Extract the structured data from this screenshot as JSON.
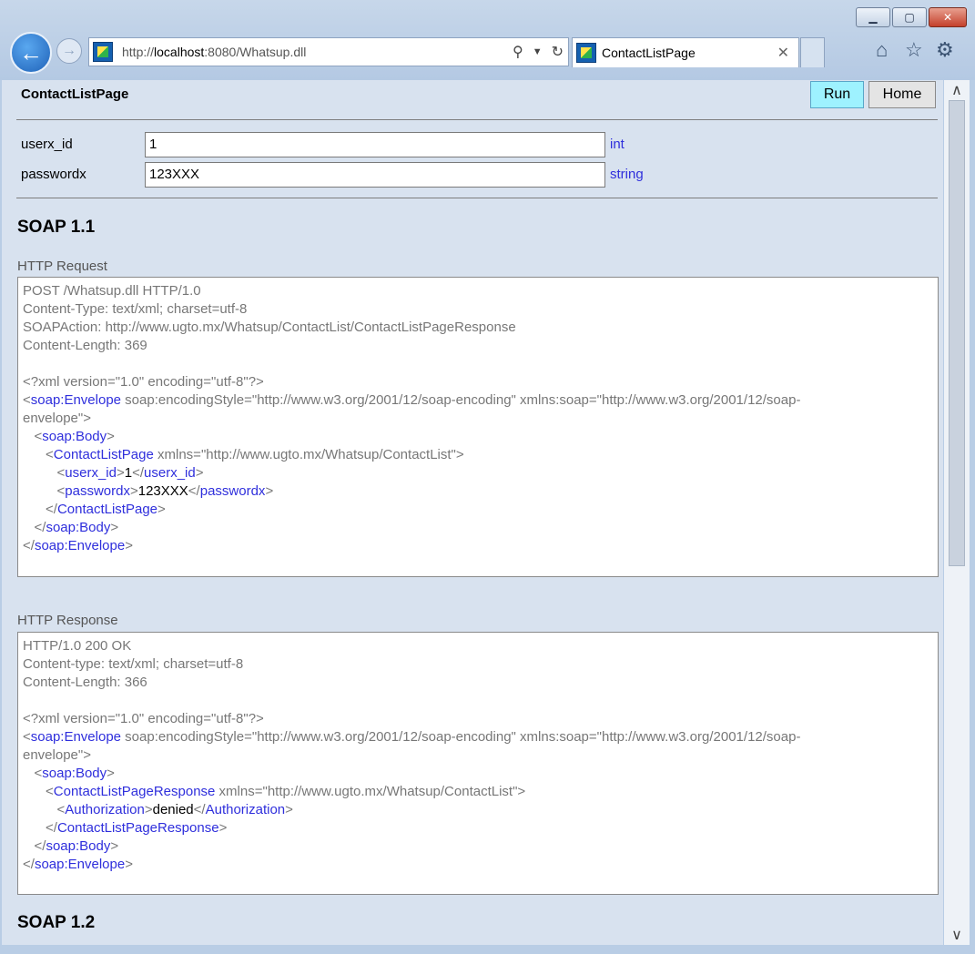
{
  "browser": {
    "url_prefix": "http://",
    "url_host": "localhost",
    "url_rest": ":8080/Whatsup.dll",
    "tab_title": "ContactListPage"
  },
  "page": {
    "title": "ContactListPage",
    "run_label": "Run",
    "home_label": "Home"
  },
  "fields": [
    {
      "label": "userx_id",
      "value": "1",
      "type": "int"
    },
    {
      "label": "passwordx",
      "value": "123XXX",
      "type": "string"
    }
  ],
  "soap11": {
    "heading": "SOAP 1.1",
    "request_label": "HTTP Request",
    "request": {
      "line1": "POST /Whatsup.dll HTTP/1.0",
      "line2": "Content-Type: text/xml; charset=utf-8",
      "line3": "SOAPAction: http://www.ugto.mx/Whatsup/ContactList/ContactListPageResponse",
      "line4": "Content-Length: 369",
      "xml_decl": "<?xml version=\"1.0\" encoding=\"utf-8\"?>",
      "envelope_attrs": " soap:encodingStyle=\"http://www.w3.org/2001/12/soap-encoding\" xmlns:soap=\"http://www.w3.org/2001/12/soap-",
      "envelope_cont": "envelope\">",
      "method": "ContactListPage",
      "method_attrs": " xmlns=\"http://www.ugto.mx/Whatsup/ContactList\">",
      "p1_name": "userx_id",
      "p1_value": "1",
      "p2_name": "passwordx",
      "p2_value": "123XXX"
    },
    "response_label": "HTTP Response",
    "response": {
      "line1": "HTTP/1.0 200 OK",
      "line2": "Content-type: text/xml; charset=utf-8",
      "line3": "Content-Length: 366",
      "xml_decl": "<?xml version=\"1.0\" encoding=\"utf-8\"?>",
      "envelope_attrs": " soap:encodingStyle=\"http://www.w3.org/2001/12/soap-encoding\" xmlns:soap=\"http://www.w3.org/2001/12/soap-",
      "envelope_cont": "envelope\">",
      "method": "ContactListPageResponse",
      "method_attrs": " xmlns=\"http://www.ugto.mx/Whatsup/ContactList\">",
      "r_name": "Authorization",
      "r_value": "denied"
    }
  },
  "soap12": {
    "heading": "SOAP 1.2"
  },
  "xml": {
    "envelope": "soap:Envelope",
    "body": "soap:Body"
  }
}
